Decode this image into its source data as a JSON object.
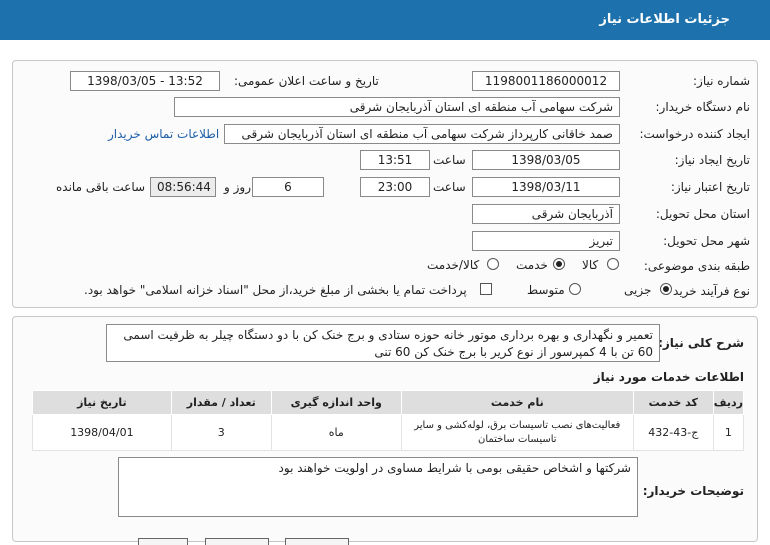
{
  "header": {
    "title": "جزئیات اطلاعات نیاز"
  },
  "form": {
    "need_number_label": "شماره نیاز:",
    "need_number": "1198001186000012",
    "announce_label": "تاریخ و ساعت اعلان عمومی:",
    "announce_value": "1398/03/05 - 13:52",
    "buyer_org_label": "نام دستگاه خریدار:",
    "buyer_org": "شرکت سهامی آب منطقه ای استان آذربایجان شرقی",
    "requester_label": "ایجاد کننده درخواست:",
    "requester": "صمد خاقانی کارپرداز شرکت سهامی آب منطقه ای استان آذربایجان شرقی",
    "contact_link": "اطلاعات تماس خریدار",
    "create_date_label": "تاریخ ایجاد نیاز:",
    "create_date": "1398/03/05",
    "time_label": "ساعت",
    "create_time": "13:51",
    "validity_label": "تاریخ اعتبار نیاز:",
    "validity_date": "1398/03/11",
    "validity_time": "23:00",
    "days": "6",
    "days_label": "روز و",
    "remaining_time": "08:56:44",
    "remaining_label": "ساعت باقی مانده",
    "province_label": "استان محل تحویل:",
    "province": "آذربایجان شرقی",
    "city_label": "شهر محل تحویل:",
    "city": "تبریز",
    "category_label": "طبقه بندی موضوعی:",
    "category_options": [
      "کالا",
      "خدمت",
      "کالا/خدمت"
    ],
    "purchase_type_label": "نوع فرآیند خرید :",
    "purchase_options": [
      "جزیی",
      "متوسط"
    ],
    "payment_note": "پرداخت تمام یا بخشی از مبلغ خرید،از محل \"اسناد خزانه اسلامی\" خواهد بود."
  },
  "summary": {
    "label": "شرح کلی نیاز:",
    "text": "تعمیر و نگهداری و بهره برداری موتور خانه حوزه ستادی و برج خنک کن با دو دستگاه چیلر به ظرفیت اسمی 60 تن با 4 کمپرسور از نوع کریر با برج خنک کن 60 تنی"
  },
  "services": {
    "title": "اطلاعات خدمات مورد نیاز",
    "columns": [
      "ردیف",
      "کد خدمت",
      "نام خدمت",
      "واحد اندازه گیری",
      "تعداد / مقدار",
      "تاریخ نیاز"
    ],
    "rows": [
      [
        "1",
        "ج-43-432",
        "فعالیت‌های نصب تاسیسات برق، لوله‌کشی و سایر تاسیسات ساختمان",
        "ماه",
        "3",
        "1398/04/01"
      ]
    ]
  },
  "buyer_notes": {
    "label": "توضیحات خریدار:",
    "text": "شرکتها و اشخاص حقیقی بومی با شرایط مساوی در اولویت خواهند بود"
  }
}
